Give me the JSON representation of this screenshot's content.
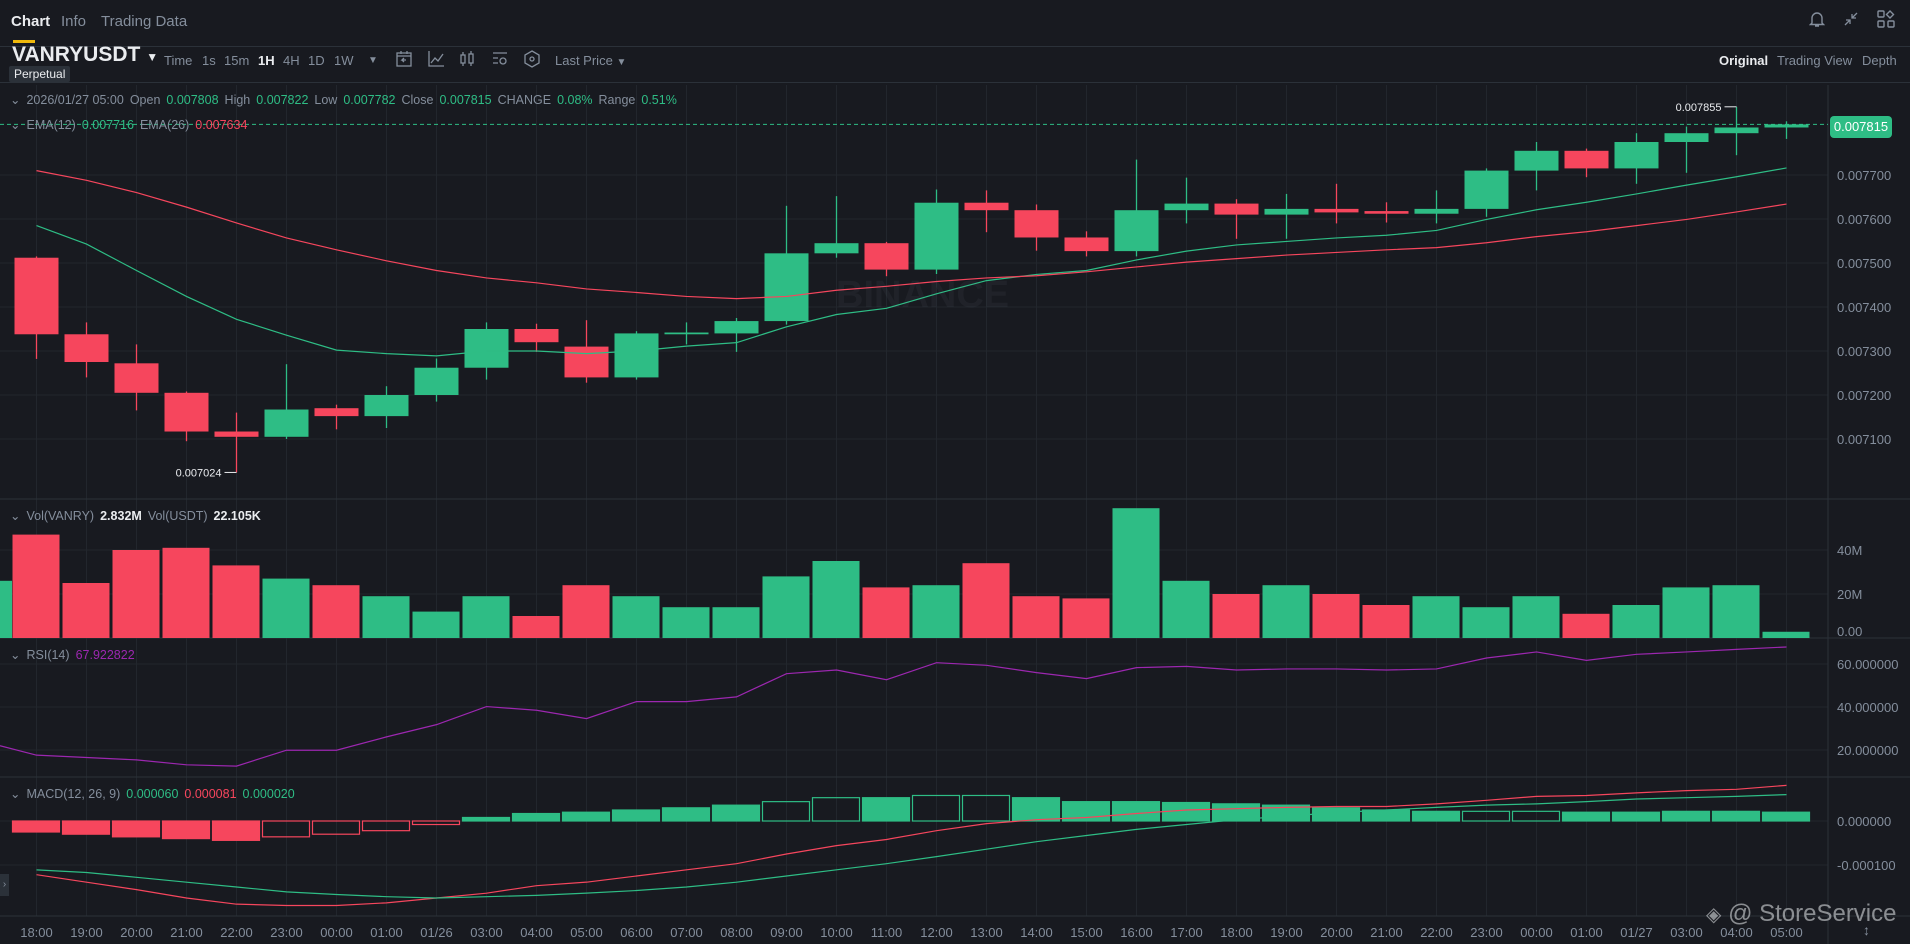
{
  "tabs": [
    {
      "label": "Chart",
      "active": true
    },
    {
      "label": "Info",
      "active": false
    },
    {
      "label": "Trading Data",
      "active": false
    }
  ],
  "header_icons": [
    "bell-icon",
    "collapse-icon",
    "layout-grid-icon"
  ],
  "symbol": {
    "name": "VANRYUSDT",
    "type": "Perpetual"
  },
  "toolbar": {
    "intervals": [
      {
        "label": "Time"
      },
      {
        "label": "1s"
      },
      {
        "label": "15m"
      },
      {
        "label": "1H",
        "active": true
      },
      {
        "label": "4H"
      },
      {
        "label": "1D"
      },
      {
        "label": "1W"
      }
    ],
    "icons": [
      "calendar-icon",
      "indicator-icon",
      "candle-type-icon",
      "settings-icon",
      "price-alert-icon"
    ],
    "price_source": "Last Price"
  },
  "views": [
    {
      "label": "Original",
      "active": true
    },
    {
      "label": "Trading View"
    },
    {
      "label": "Depth"
    }
  ],
  "ohlc_legend": {
    "date": "2026/01/27 05:00",
    "open_label": "Open",
    "open": "0.007808",
    "high_label": "High",
    "high": "0.007822",
    "low_label": "Low",
    "low": "0.007782",
    "close_label": "Close",
    "close": "0.007815",
    "change_label": "CHANGE",
    "change": "0.08%",
    "range_label": "Range",
    "range": "0.51%"
  },
  "ema_legend": {
    "ema12_label": "EMA(12)",
    "ema12": "0.007716",
    "ema26_label": "EMA(26)",
    "ema26": "0.007634"
  },
  "vol_legend": {
    "base_label": "Vol(VANRY)",
    "base": "2.832M",
    "quote_label": "Vol(USDT)",
    "quote": "22.105K"
  },
  "rsi_legend": {
    "label": "RSI(14)",
    "value": "67.922822"
  },
  "macd_legend": {
    "label": "MACD(12, 26, 9)",
    "dif": "0.000060",
    "dea": "0.000081",
    "hist": "0.000020"
  },
  "current_price": "0.007815",
  "watermark": "BINANCE",
  "footer_watermark": "@ StoreService",
  "colors": {
    "up": "#2ebd85",
    "down": "#f6465d",
    "ema12": "#2ebd85",
    "ema26": "#f6465d",
    "rsi": "#9c27b0",
    "bg": "#181a20"
  },
  "chart_data": {
    "type": "candlestick",
    "time_labels": [
      "18:00",
      "19:00",
      "20:00",
      "21:00",
      "22:00",
      "23:00",
      "00:00",
      "01:00",
      "01/26",
      "03:00",
      "04:00",
      "05:00",
      "06:00",
      "07:00",
      "08:00",
      "09:00",
      "10:00",
      "11:00",
      "12:00",
      "13:00",
      "14:00",
      "15:00",
      "16:00",
      "17:00",
      "18:00",
      "19:00",
      "20:00",
      "21:00",
      "22:00",
      "23:00",
      "00:00",
      "01:00",
      "01/27",
      "03:00",
      "04:00",
      "05:00"
    ],
    "price_axis": {
      "ticks": [
        "0.007700",
        "0.007600",
        "0.007500",
        "0.007400",
        "0.007300",
        "0.007200",
        "0.007100"
      ],
      "tick_values": [
        0.0077,
        0.0076,
        0.0075,
        0.0074,
        0.0073,
        0.0072,
        0.0071
      ]
    },
    "high_marker": "0.007855",
    "low_marker": "0.007024",
    "ohlc": [
      [
        0.007512,
        0.007515,
        0.007282,
        0.007338
      ],
      [
        0.007338,
        0.007365,
        0.00724,
        0.007275
      ],
      [
        0.007272,
        0.007315,
        0.007165,
        0.007205
      ],
      [
        0.007205,
        0.007208,
        0.007095,
        0.007117
      ],
      [
        0.007117,
        0.00716,
        0.007024,
        0.007105
      ],
      [
        0.007105,
        0.00727,
        0.0071,
        0.007167
      ],
      [
        0.00717,
        0.007178,
        0.007122,
        0.007152
      ],
      [
        0.007152,
        0.00722,
        0.007125,
        0.0072
      ],
      [
        0.0072,
        0.007283,
        0.007185,
        0.007262
      ],
      [
        0.007262,
        0.007365,
        0.007235,
        0.00735
      ],
      [
        0.00735,
        0.007362,
        0.007298,
        0.00732
      ],
      [
        0.00731,
        0.00737,
        0.007228,
        0.00724
      ],
      [
        0.00724,
        0.007345,
        0.007235,
        0.00734
      ],
      [
        0.007338,
        0.007365,
        0.007315,
        0.007342
      ],
      [
        0.00734,
        0.007375,
        0.007298,
        0.007368
      ],
      [
        0.007368,
        0.00763,
        0.00736,
        0.007522
      ],
      [
        0.007522,
        0.007652,
        0.007512,
        0.007545
      ],
      [
        0.007545,
        0.007548,
        0.00747,
        0.007485
      ],
      [
        0.007485,
        0.007667,
        0.007475,
        0.007637
      ],
      [
        0.007637,
        0.007665,
        0.00757,
        0.00762
      ],
      [
        0.00762,
        0.007633,
        0.007528,
        0.007558
      ],
      [
        0.007558,
        0.007572,
        0.007515,
        0.007527
      ],
      [
        0.007527,
        0.007735,
        0.007515,
        0.00762
      ],
      [
        0.00762,
        0.007694,
        0.00759,
        0.007635
      ],
      [
        0.007635,
        0.007645,
        0.007555,
        0.00761
      ],
      [
        0.00761,
        0.007657,
        0.007555,
        0.007623
      ],
      [
        0.007623,
        0.00768,
        0.00759,
        0.007615
      ],
      [
        0.007618,
        0.007638,
        0.007592,
        0.007612
      ],
      [
        0.007612,
        0.007665,
        0.00759,
        0.007623
      ],
      [
        0.007623,
        0.007715,
        0.007605,
        0.00771
      ],
      [
        0.00771,
        0.007775,
        0.007665,
        0.007755
      ],
      [
        0.007755,
        0.00776,
        0.007695,
        0.007715
      ],
      [
        0.007715,
        0.007795,
        0.00768,
        0.007775
      ],
      [
        0.007775,
        0.00781,
        0.007705,
        0.007795
      ],
      [
        0.007795,
        0.007855,
        0.007745,
        0.007808
      ],
      [
        0.007808,
        0.007822,
        0.007782,
        0.007815
      ]
    ],
    "ema12": [
      0.007585,
      0.007543,
      0.007483,
      0.007424,
      0.007372,
      0.007336,
      0.007302,
      0.007294,
      0.007289,
      0.0073,
      0.0073,
      0.007294,
      0.0073,
      0.007311,
      0.007319,
      0.007355,
      0.007383,
      0.007397,
      0.00743,
      0.00746,
      0.007474,
      0.007483,
      0.007507,
      0.007527,
      0.007541,
      0.007549,
      0.007557,
      0.007563,
      0.007574,
      0.007599,
      0.007621,
      0.007638,
      0.007657,
      0.007677,
      0.007696,
      0.007716
    ],
    "ema26": [
      0.00771,
      0.007688,
      0.00766,
      0.007627,
      0.007591,
      0.007557,
      0.00753,
      0.007505,
      0.007483,
      0.007466,
      0.007455,
      0.007441,
      0.007433,
      0.007424,
      0.007419,
      0.007424,
      0.007438,
      0.007447,
      0.007458,
      0.007466,
      0.007471,
      0.00748,
      0.007491,
      0.007502,
      0.00751,
      0.007518,
      0.007524,
      0.00753,
      0.007535,
      0.007546,
      0.00756,
      0.007571,
      0.007585,
      0.007599,
      0.007616,
      0.007634
    ],
    "volume_axis": {
      "ticks": [
        "40M",
        "20M",
        "0.00"
      ],
      "tick_values": [
        40,
        20,
        0
      ]
    },
    "volume_millions": [
      47,
      25,
      40,
      41,
      33,
      27,
      24,
      19,
      12,
      19,
      10,
      24,
      19,
      14,
      14,
      28,
      35,
      23,
      24,
      34,
      19,
      18,
      59,
      26,
      20,
      24,
      20,
      15,
      19,
      14,
      19,
      11,
      15,
      23,
      24,
      2.832
    ],
    "rsi_axis": {
      "ticks": [
        "60.000000",
        "40.000000",
        "20.000000"
      ],
      "tick_values": [
        60,
        40,
        20
      ]
    },
    "rsi": [
      17.6,
      16.5,
      15.4,
      13.1,
      12.5,
      19.9,
      19.9,
      26.1,
      31.8,
      40.2,
      38.5,
      34.6,
      42.5,
      42.5,
      44.7,
      55.5,
      57.2,
      52.7,
      60.6,
      59.4,
      56.0,
      53.2,
      58.3,
      58.9,
      57.2,
      57.7,
      57.7,
      57.2,
      57.7,
      62.8,
      65.6,
      61.7,
      64.5,
      65.6,
      66.8,
      67.92
    ],
    "macd_axis": {
      "ticks": [
        "0.000000",
        "-0.000100"
      ],
      "tick_values": [
        0,
        -0.0001
      ]
    },
    "macd_hist": [
      -2.5e-05,
      -3e-05,
      -3.6e-05,
      -4e-05,
      -4.4e-05,
      -3.6e-05,
      -3e-05,
      -2.2e-05,
      -8e-06,
      8e-06,
      1.7e-05,
      2e-05,
      2.5e-05,
      3e-05,
      3.6e-05,
      4.4e-05,
      5.3e-05,
      5.3e-05,
      5.8e-05,
      5.8e-05,
      5.3e-05,
      4.4e-05,
      4.4e-05,
      4.2e-05,
      3.9e-05,
      3.6e-05,
      3e-05,
      2.5e-05,
      2.2e-05,
      2.2e-05,
      2.2e-05,
      2e-05,
      2e-05,
      2.2e-05,
      2.2e-05,
      2e-05
    ],
    "macd_hist_hollow": [
      false,
      false,
      false,
      false,
      false,
      true,
      true,
      true,
      true,
      false,
      false,
      false,
      false,
      false,
      false,
      true,
      true,
      false,
      true,
      true,
      false,
      false,
      false,
      false,
      false,
      false,
      false,
      false,
      false,
      true,
      true,
      false,
      false,
      false,
      false,
      false
    ],
    "macd_dif": [
      -0.000111,
      -0.000117,
      -0.000128,
      -0.000139,
      -0.00015,
      -0.000161,
      -0.000167,
      -0.000172,
      -0.000175,
      -0.000172,
      -0.000169,
      -0.000164,
      -0.000158,
      -0.00015,
      -0.000139,
      -0.000125,
      -0.000111,
      -9.7e-05,
      -8.1e-05,
      -6.4e-05,
      -4.7e-05,
      -3.3e-05,
      -1.9e-05,
      -8e-06,
      3e-06,
      1.1e-05,
      1.9e-05,
      2.5e-05,
      3.1e-05,
      3.6e-05,
      3.9e-05,
      4.4e-05,
      5e-05,
      5.3e-05,
      5.6e-05,
      6e-05
    ],
    "macd_dea": [
      -0.000122,
      -0.000139,
      -0.000156,
      -0.000175,
      -0.000189,
      -0.000192,
      -0.000192,
      -0.000186,
      -0.000175,
      -0.000164,
      -0.000147,
      -0.000139,
      -0.000125,
      -0.000111,
      -9.7e-05,
      -7.5e-05,
      -5.6e-05,
      -4.2e-05,
      -2.2e-05,
      -6e-06,
      3e-06,
      8e-06,
      1.7e-05,
      2.5e-05,
      2.8e-05,
      3.1e-05,
      3.3e-05,
      3.3e-05,
      3.9e-05,
      4.7e-05,
      5.6e-05,
      5.8e-05,
      6.4e-05,
      6.9e-05,
      7.2e-05,
      8.1e-05
    ]
  }
}
